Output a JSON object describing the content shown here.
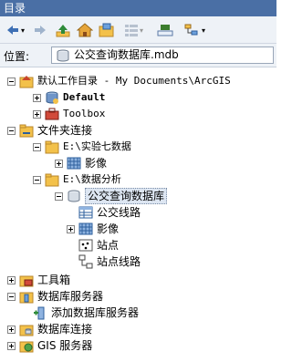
{
  "window": {
    "title": "目录"
  },
  "location": {
    "label": "位置:",
    "value": "公交查询数据库.mdb"
  },
  "tree": {
    "root": "默认工作目录 - My Documents\\ArcGIS",
    "default_label": "Default",
    "toolbox_label": "Toolbox",
    "folder_connections": "文件夹连接",
    "e_exp7": "E:\\实验七数据",
    "image1": "影像",
    "e_analysis": "E:\\数据分析",
    "db": "公交查询数据库",
    "bus_lines": "公交线路",
    "image2": "影像",
    "stations": "站点",
    "station_lines": "站点线路",
    "toolbox_cn": "工具箱",
    "db_servers": "数据库服务器",
    "add_db_server": "添加数据库服务器",
    "db_connections": "数据库连接",
    "gis_servers": "GIS 服务器"
  }
}
